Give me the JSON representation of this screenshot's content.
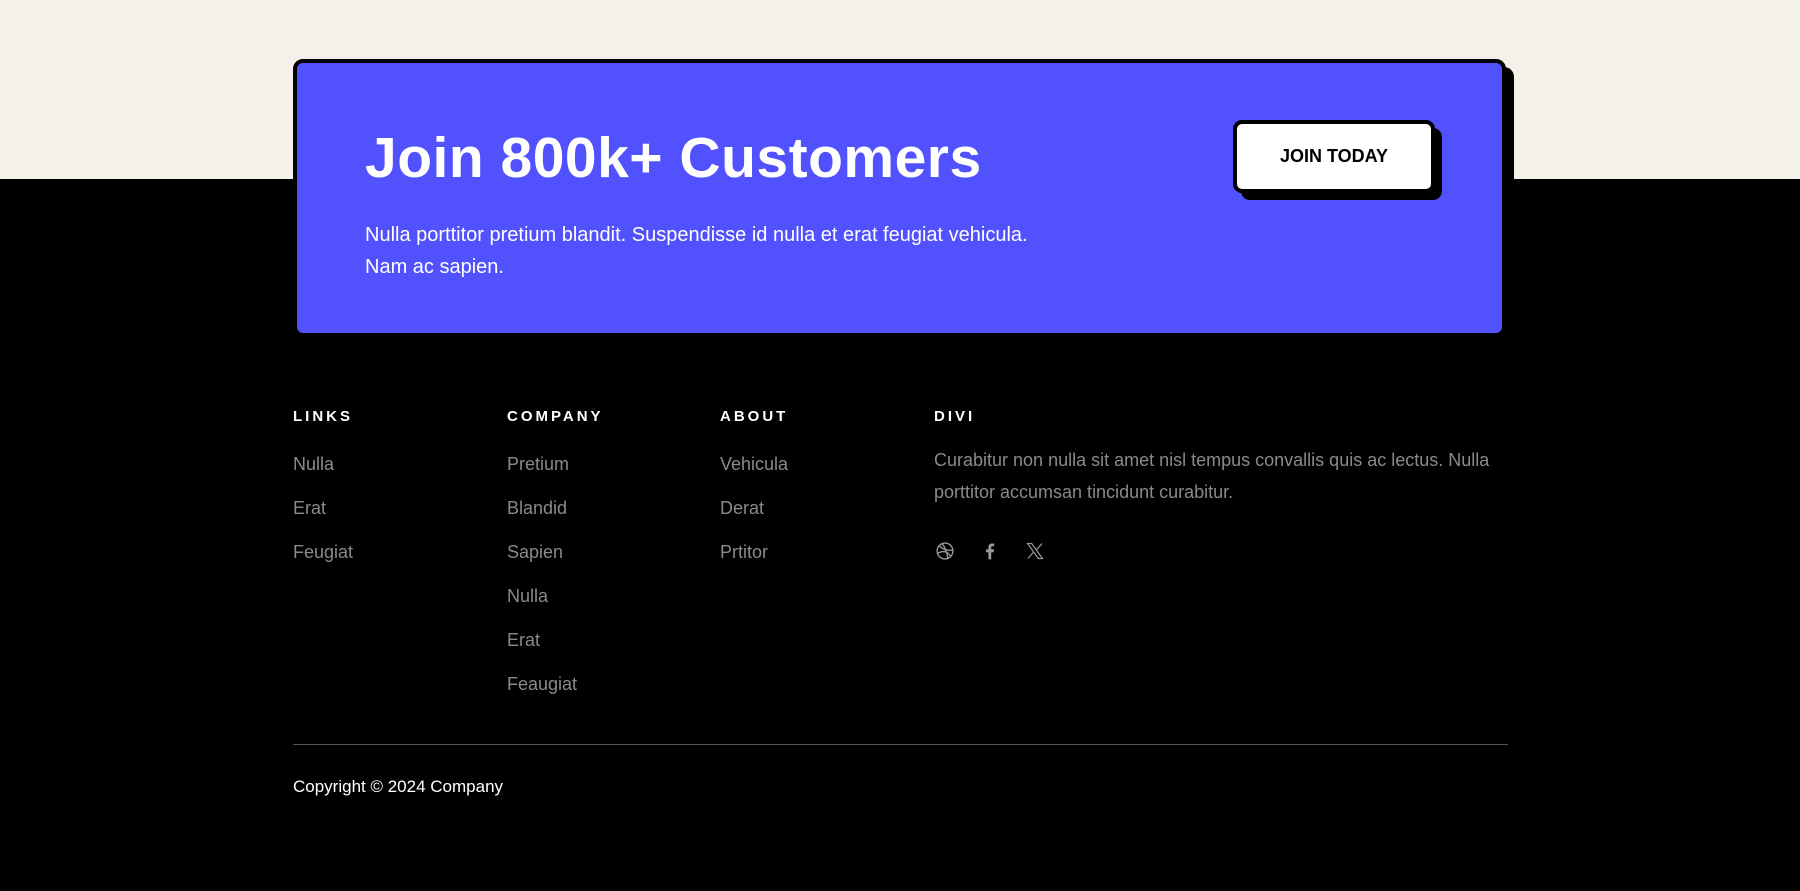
{
  "cta": {
    "title": "Join 800k+ Customers",
    "text": "Nulla porttitor pretium blandit. Suspendisse id nulla et erat feugiat vehicula. Nam ac sapien.",
    "button_label": "JOIN TODAY"
  },
  "footer": {
    "columns": [
      {
        "heading": "LINKS",
        "items": [
          "Nulla",
          "Erat",
          "Feugiat"
        ]
      },
      {
        "heading": "COMPANY",
        "items": [
          "Pretium",
          "Blandid",
          "Sapien",
          "Nulla",
          "Erat",
          "Feaugiat"
        ]
      },
      {
        "heading": "ABOUT",
        "items": [
          "Vehicula",
          "Derat",
          "Prtitor"
        ]
      }
    ],
    "divi": {
      "heading": "DIVI",
      "text": "Curabitur non nulla sit amet nisl tempus convallis quis ac lectus. Nulla porttitor accumsan tincidunt curabitur.",
      "socials": [
        "dribbble-icon",
        "facebook-icon",
        "x-twitter-icon"
      ]
    },
    "copyright": "Copyright © 2024 Company"
  },
  "colors": {
    "accent": "#5151fd",
    "top_background": "#f5f1ea",
    "footer_background": "#000000",
    "muted_text": "#8a8a8a"
  }
}
